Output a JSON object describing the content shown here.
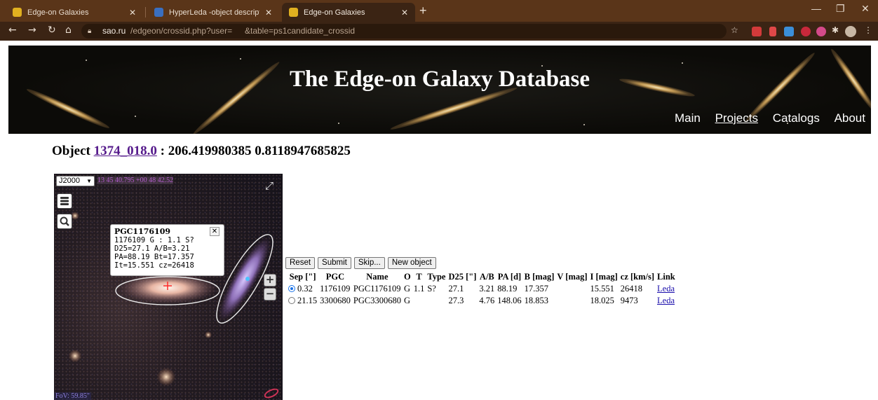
{
  "browser": {
    "tabs": [
      {
        "title": "Edge-on Galaxies",
        "active": false
      },
      {
        "title": "HyperLeda -object description",
        "active": false
      },
      {
        "title": "Edge-on Galaxies",
        "active": true
      }
    ],
    "url": {
      "host": "sao.ru",
      "path": "/edgeon/crossid.php?user=",
      "query": "&table=ps1candidate_crossid"
    },
    "colors": {
      "tabbar": "#5a3519",
      "toolbar": "#3b2414"
    }
  },
  "site": {
    "title": "The Edge-on Galaxy Database",
    "nav": [
      "Main",
      "Projects",
      "Catalogs",
      "About"
    ]
  },
  "object": {
    "label": "Object",
    "id": "1374_018.0",
    "coords": ": 206.419980385 0.8118947685825"
  },
  "sky_view": {
    "frame": "J2000",
    "cursor_coords": "13 45 40.795 +00 48 42.52",
    "fov": "FoV: 59.85\"",
    "popup": {
      "name": "PGC1176109",
      "lines": [
        "1176109 G : 1.1 S?",
        "D25=27.1 A/B=3.21",
        "PA=88.19 Bt=17.357",
        "It=15.551 cz=26418"
      ]
    }
  },
  "controls": {
    "reset": "Reset",
    "submit": "Submit",
    "skip": "Skip...",
    "new_object": "New object"
  },
  "table": {
    "headers": [
      "Sep [\"]",
      "PGC",
      "Name",
      "O",
      "T",
      "Type",
      "D25 [\"]",
      "A/B",
      "PA [d]",
      "B [mag]",
      "V [mag]",
      "I [mag]",
      "cz [km/s]",
      "Link"
    ],
    "rows": [
      {
        "selected": true,
        "sep": "0.32",
        "pgc": "1176109",
        "name": "PGC1176109",
        "o": "G",
        "t": "1.1",
        "type": "S?",
        "d25": "27.1",
        "ab": "3.21",
        "pa": "88.19",
        "b": "17.357",
        "v": "",
        "i": "15.551",
        "cz": "26418",
        "link": "Leda"
      },
      {
        "selected": false,
        "sep": "21.15",
        "pgc": "3300680",
        "name": "PGC3300680",
        "o": "G",
        "t": "",
        "type": "",
        "d25": "27.3",
        "ab": "4.76",
        "pa": "148.06",
        "b": "18.853",
        "v": "",
        "i": "18.025",
        "cz": "9473",
        "link": "Leda"
      }
    ]
  }
}
